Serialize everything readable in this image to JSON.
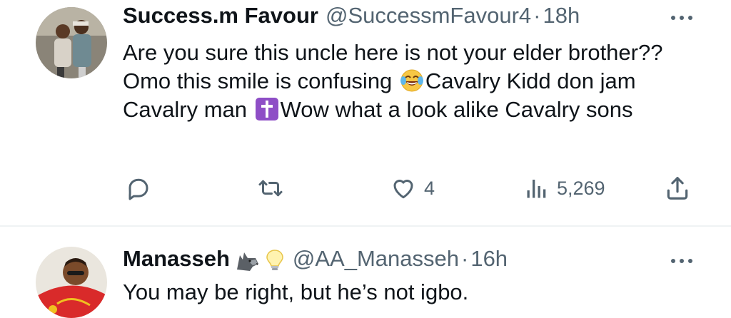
{
  "tweets": [
    {
      "author": {
        "name": "Success.m Favour",
        "handle": "@SuccessmFavour4",
        "time": "18h"
      },
      "text_parts": [
        "Are you sure this uncle here is not your elder brother?? Omo this smile is confusing ",
        "Cavalry Kidd don jam Cavalry man ",
        "Wow what a look alike Cavalry sons"
      ],
      "inline_emojis": [
        "face-with-tears-of-joy-emoji",
        "latin-cross-emoji"
      ],
      "stats": {
        "replies": "",
        "retweets": "",
        "likes": "4",
        "views": "5,269"
      }
    },
    {
      "author": {
        "name": "Manasseh",
        "name_emojis": [
          "wolf-emoji",
          "lightbulb-emoji"
        ],
        "handle": "@AA_Manasseh",
        "time": "16h"
      },
      "text": "You may be right, but he’s not igbo."
    }
  ],
  "separator": "·",
  "icons": [
    "reply-icon",
    "retweet-icon",
    "like-icon",
    "views-icon",
    "share-icon",
    "more-icon"
  ],
  "colors": {
    "text_primary": "#0f1419",
    "text_secondary": "#536471",
    "divider": "#eff3f4"
  }
}
